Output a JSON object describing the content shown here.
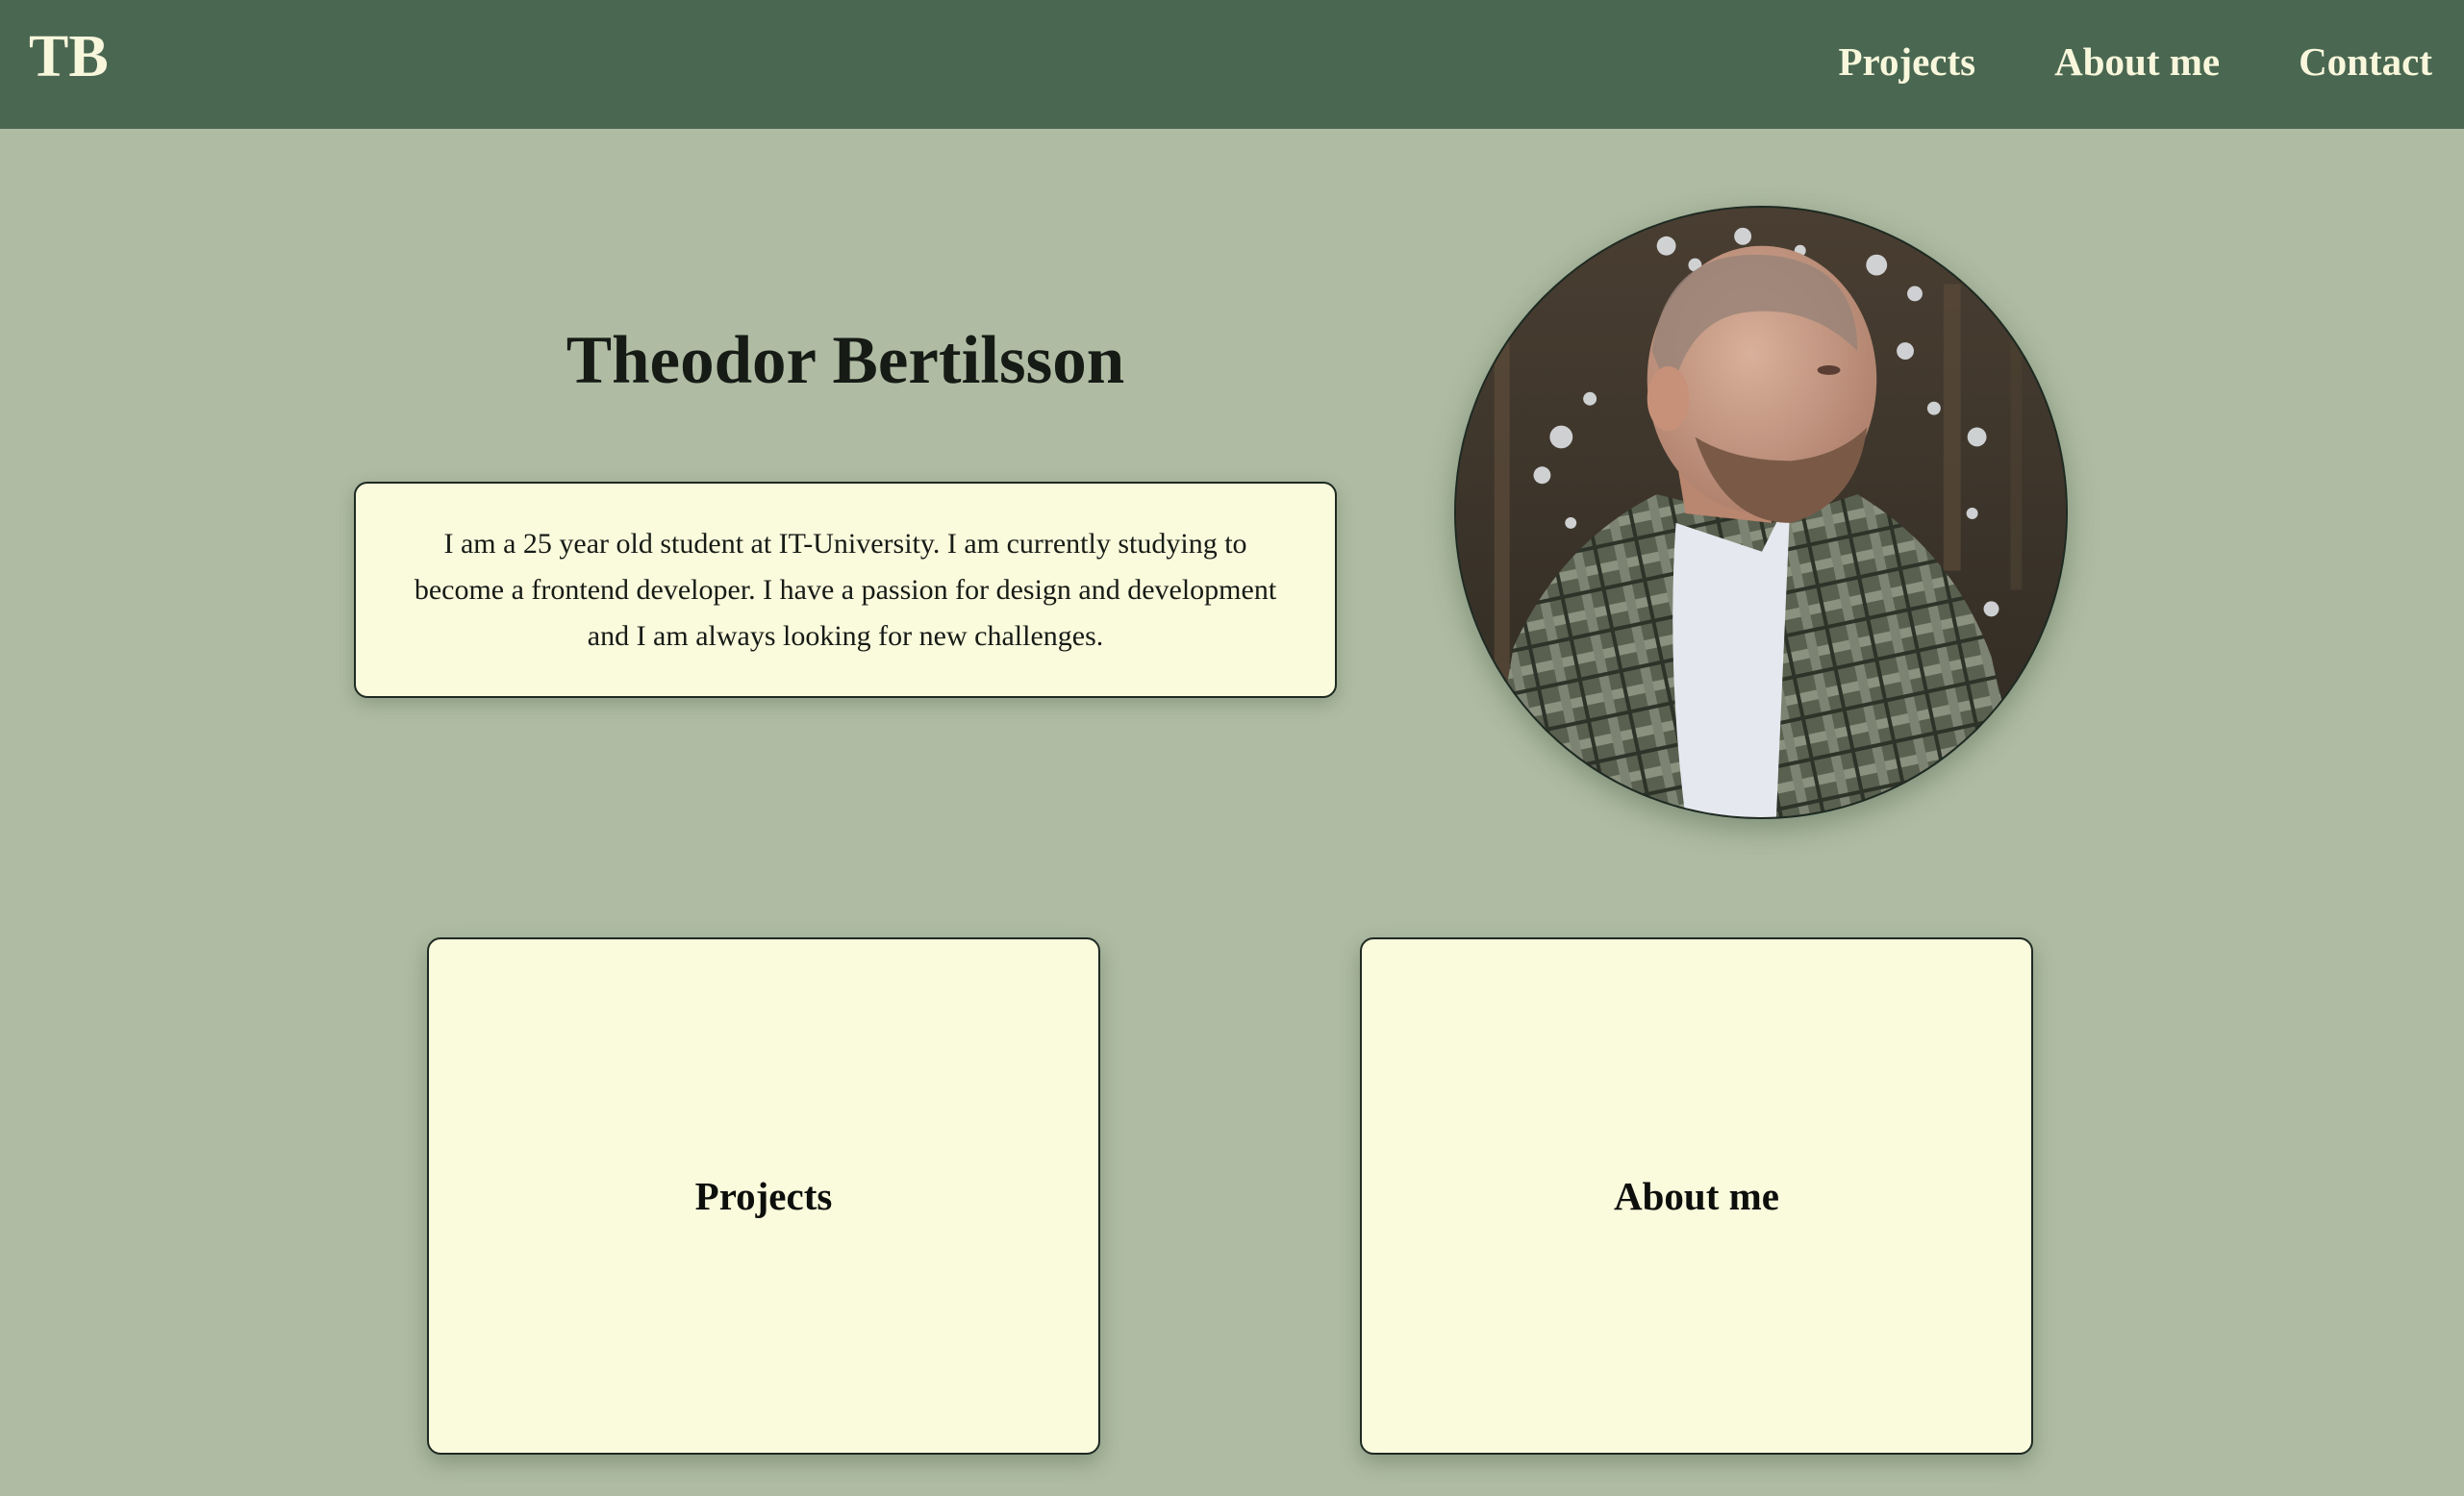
{
  "header": {
    "logo": "TB",
    "nav": [
      {
        "label": "Projects"
      },
      {
        "label": "About me"
      },
      {
        "label": "Contact"
      }
    ]
  },
  "hero": {
    "name": "Theodor Bertilsson",
    "intro": "I am a 25 year old student at IT-University. I am currently studying to become a frontend developer. I have a passion for design and development and I am always looking for new challenges."
  },
  "cards": [
    {
      "label": "Projects"
    },
    {
      "label": "About me"
    }
  ],
  "colors": {
    "background": "#afbca3",
    "header": "#4a6751",
    "header_text": "#f8f7dc",
    "card_background": "#fafadc",
    "border": "#1d2a22"
  }
}
